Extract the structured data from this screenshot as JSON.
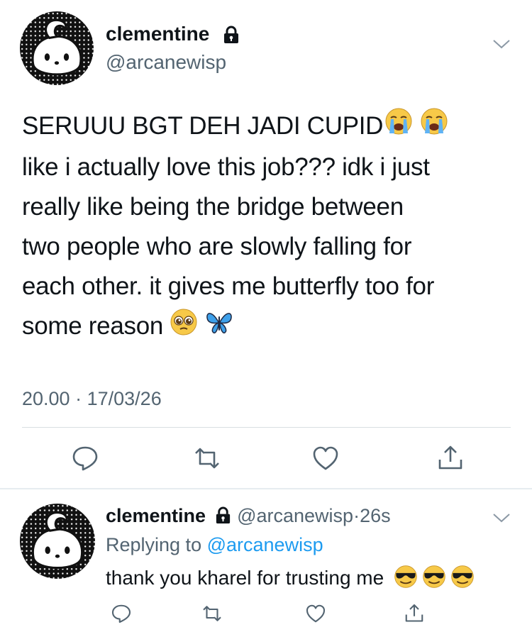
{
  "main_tweet": {
    "display_name": "clementine",
    "handle": "@arcanewisp",
    "text_lines": [
      "SERUUU BGT DEH JADI CUPID",
      "like i actually love this job??? idk i just",
      "really like being the bridge between",
      "two people who are slowly falling for",
      "each other. it gives me butterfly too for",
      "some reason"
    ],
    "time": "20.00",
    "separator": "·",
    "date": "17/03/26"
  },
  "reply_tweet": {
    "display_name": "clementine",
    "handle": "@arcanewisp",
    "separator": "·",
    "age": "26s",
    "replying_prefix": "Replying to",
    "replying_handle": "@arcanewisp",
    "text": "thank you kharel for trusting me"
  },
  "icons": {
    "lock": "lock-icon",
    "chevron": "chevron-down-icon",
    "reply": "reply-icon",
    "retweet": "retweet-icon",
    "like": "heart-icon",
    "share": "share-icon",
    "emoji_crying": "loudly-crying-face-emoji",
    "emoji_pleading": "pleading-face-emoji",
    "emoji_butterfly": "butterfly-emoji",
    "emoji_sunglasses": "smiling-face-with-sunglasses-emoji"
  },
  "colors": {
    "text": "#0f1419",
    "secondary": "#536471",
    "link": "#1d9bf0",
    "divider": "#d9dee2"
  }
}
